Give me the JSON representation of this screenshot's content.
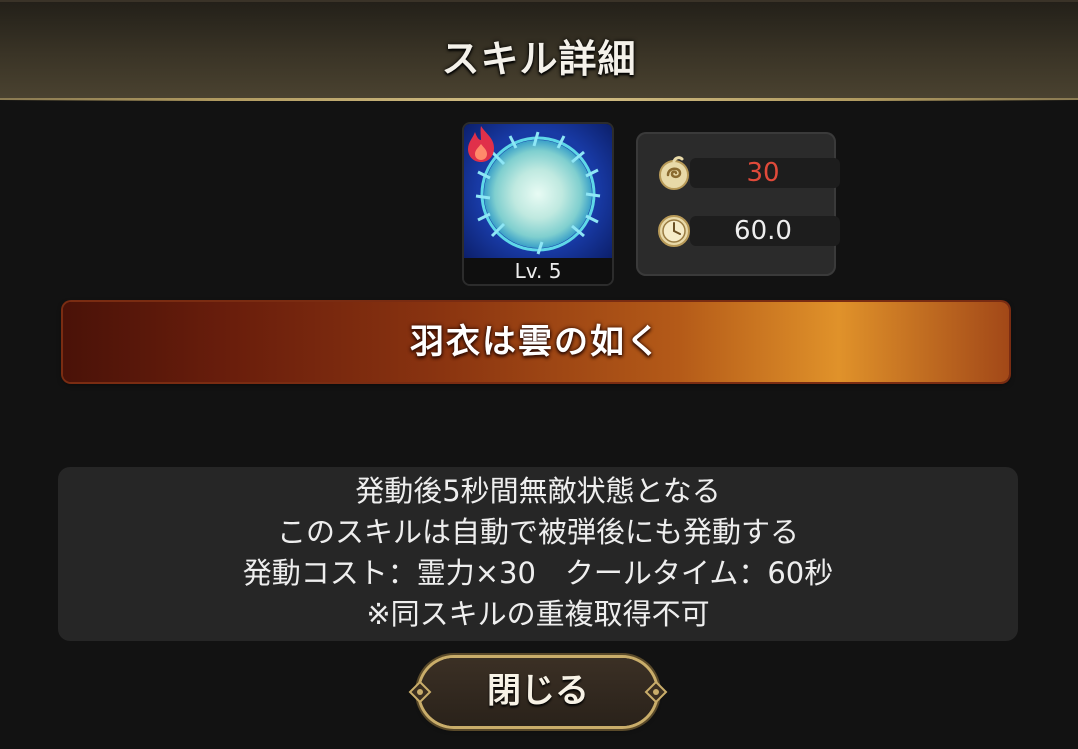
{
  "dialog": {
    "title": "スキル詳細"
  },
  "skill": {
    "icon": "ice-orb-skill-icon",
    "element_icon": "fire-element-icon",
    "level_label": "Lv. 5",
    "name": "羽衣は雲の如く"
  },
  "stats": {
    "cost": {
      "icon": "spirit-cost-icon",
      "value": "30",
      "color": "#e04a3a"
    },
    "cooldown": {
      "icon": "stopwatch-icon",
      "value": "60.0",
      "color": "#eeeeee"
    }
  },
  "description": {
    "lines": [
      "発動後5秒間無敵状態となる",
      "このスキルは自動で被弾後にも発動する",
      "発動コスト：霊力×30　クールタイム：60秒",
      "※同スキルの重複取得不可"
    ]
  },
  "buttons": {
    "close_label": "閉じる"
  },
  "colors": {
    "accent_gold": "#c9ad6a",
    "banner_red": "#8a3410",
    "panel_bg": "#262626"
  }
}
